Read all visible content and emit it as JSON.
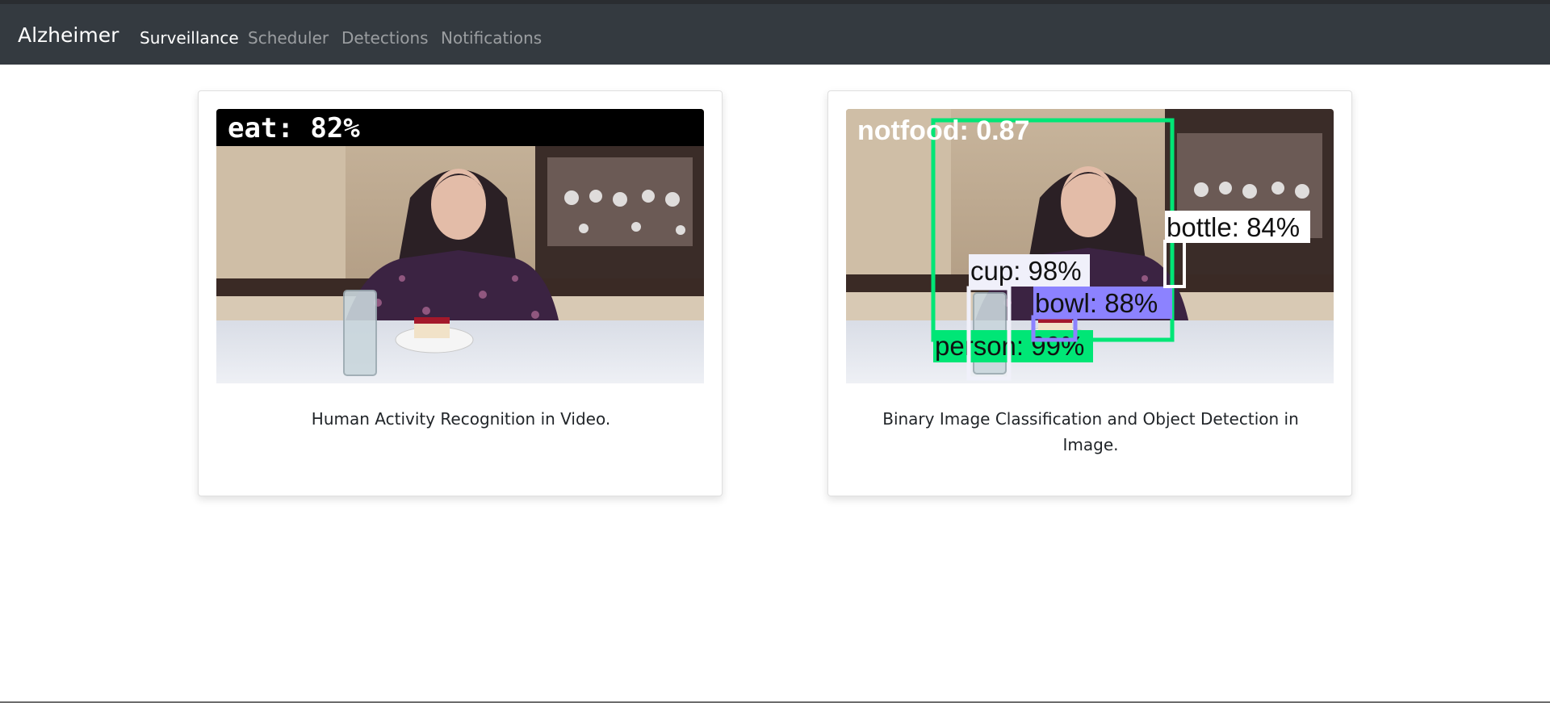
{
  "navbar": {
    "brand": "Alzheimer",
    "links": [
      {
        "label": "Surveillance",
        "active": true
      },
      {
        "label": "Scheduler",
        "active": false
      },
      {
        "label": "Detections",
        "active": false
      },
      {
        "label": "Notifications",
        "active": false
      }
    ]
  },
  "cards": [
    {
      "overlay_label": "eat: 82%",
      "caption": "Human Activity Recognition in Video."
    },
    {
      "overlay_label": "notfood: 0.87",
      "detections": [
        {
          "label": "bottle: 84%",
          "color": "#ffffff"
        },
        {
          "label": "cup: 98%",
          "color": "#f0f0fa"
        },
        {
          "label": "bowl: 88%",
          "color": "#8c82ff"
        },
        {
          "label": "person: 99%",
          "color": "#00e676"
        }
      ],
      "caption": "Binary Image Classification and Object Detection in Image."
    }
  ],
  "colors": {
    "navbar_bg": "#343a40",
    "nav_active": "#ffffff",
    "nav_inactive": "#9a9da0"
  }
}
